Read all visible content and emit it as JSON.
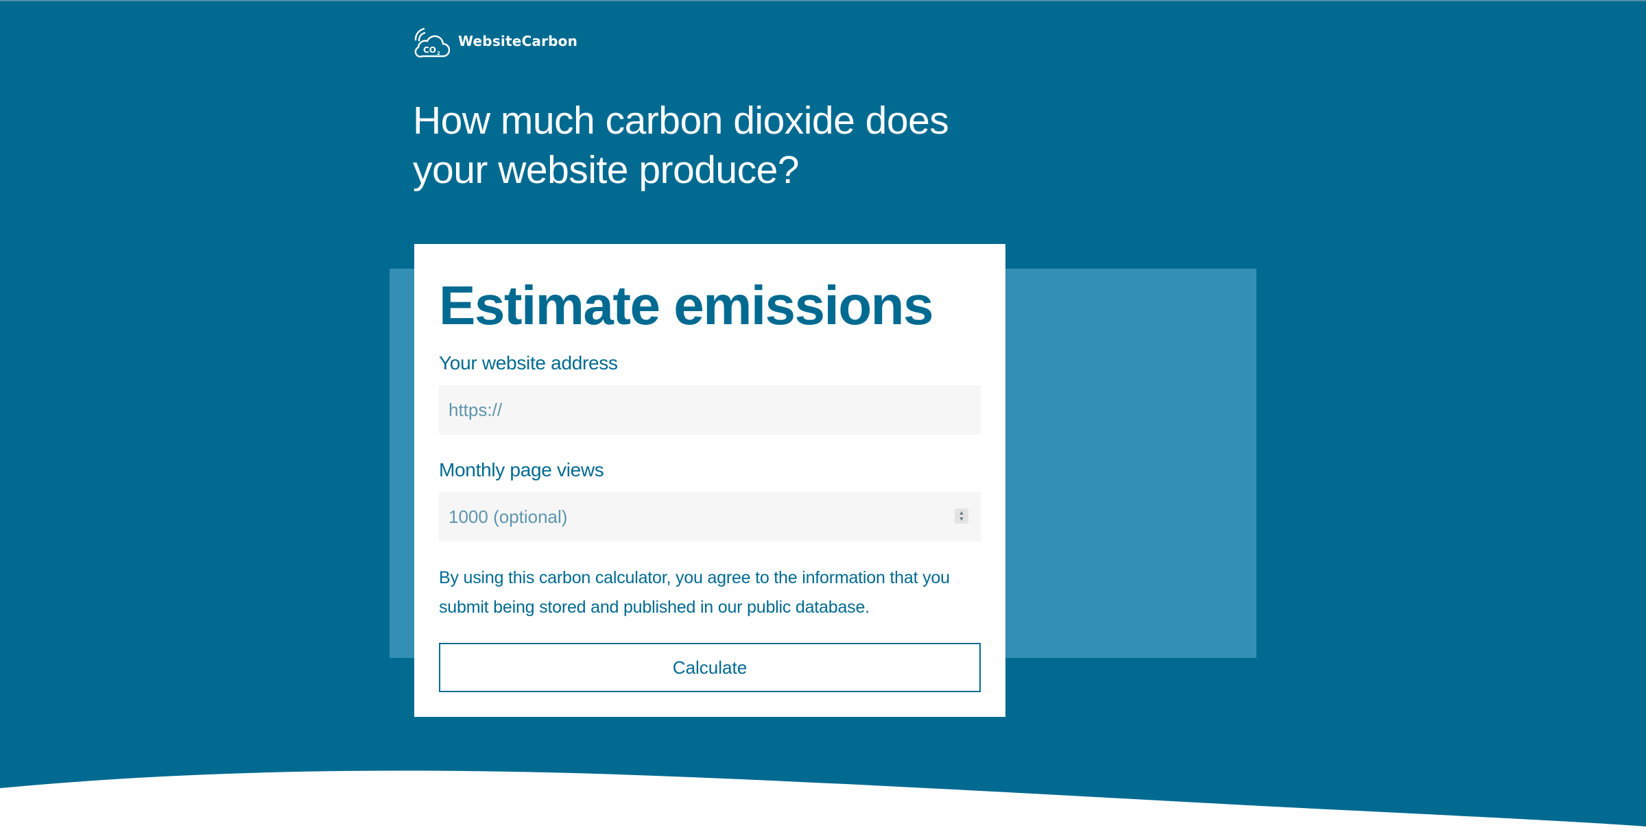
{
  "brand": {
    "name": "WebsiteCarbon",
    "logo_icon": "co2-cloud-icon",
    "logo_glyph": "CO2"
  },
  "hero": {
    "title": "How much carbon dioxide does your website produce?"
  },
  "form": {
    "title": "Estimate emissions",
    "url_label": "Your website address",
    "url_placeholder": "https://",
    "url_value": "",
    "views_label": "Monthly page views",
    "views_placeholder": "1000 (optional)",
    "views_value": "",
    "consent_text": "By using this carbon calculator, you agree to the information that you submit being stored and published in our public database.",
    "submit_label": "Calculate"
  },
  "colors": {
    "background": "#006a91",
    "backdrop": "#338fb4",
    "card": "#ffffff",
    "accent": "#006a91",
    "input_bg": "#f6f6f6"
  }
}
